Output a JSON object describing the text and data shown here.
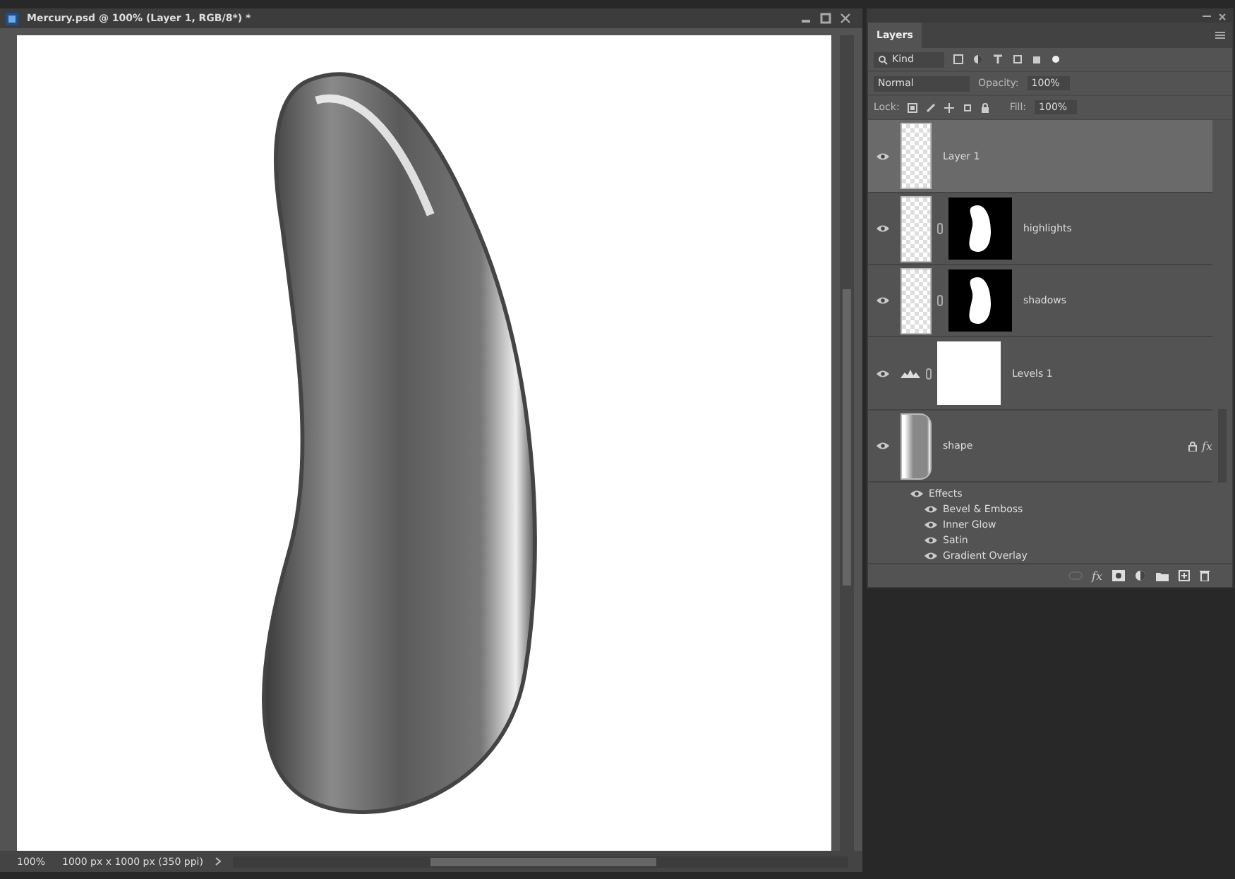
{
  "document": {
    "title": "Mercury.psd @ 100% (Layer 1, RGB/8*) *"
  },
  "status_bar": {
    "zoom": "100%",
    "doc_info": "1000 px x 1000 px (350 ppi)"
  },
  "layers_panel": {
    "tabs": [
      {
        "label": "Layers",
        "selected": true
      }
    ],
    "filter": "Kind",
    "blend_mode": "Normal",
    "opacity_label": "Opacity:",
    "opacity": "100%",
    "lock_label": "Lock:",
    "fill_label": "Fill:",
    "fill": "100%",
    "layers": [
      {
        "kind": "pixel",
        "name": "Layer 1",
        "selected": true,
        "visible": true
      },
      {
        "kind": "masked",
        "name": "highlights",
        "selected": false,
        "visible": true
      },
      {
        "kind": "masked",
        "name": "shadows",
        "selected": false,
        "visible": true
      },
      {
        "kind": "adjustment",
        "name": "Levels 1",
        "selected": false,
        "visible": true
      },
      {
        "kind": "shape",
        "name": "shape",
        "selected": false,
        "visible": true,
        "fx_indicator": "fx",
        "effects": {
          "label": "Effects",
          "items": [
            {
              "name": "Bevel & Emboss",
              "visible": true
            },
            {
              "name": "Inner Glow",
              "visible": true
            },
            {
              "name": "Satin",
              "visible": true
            },
            {
              "name": "Gradient Overlay",
              "visible": true
            }
          ]
        }
      }
    ],
    "footer": {
      "style_button": "fx"
    }
  }
}
